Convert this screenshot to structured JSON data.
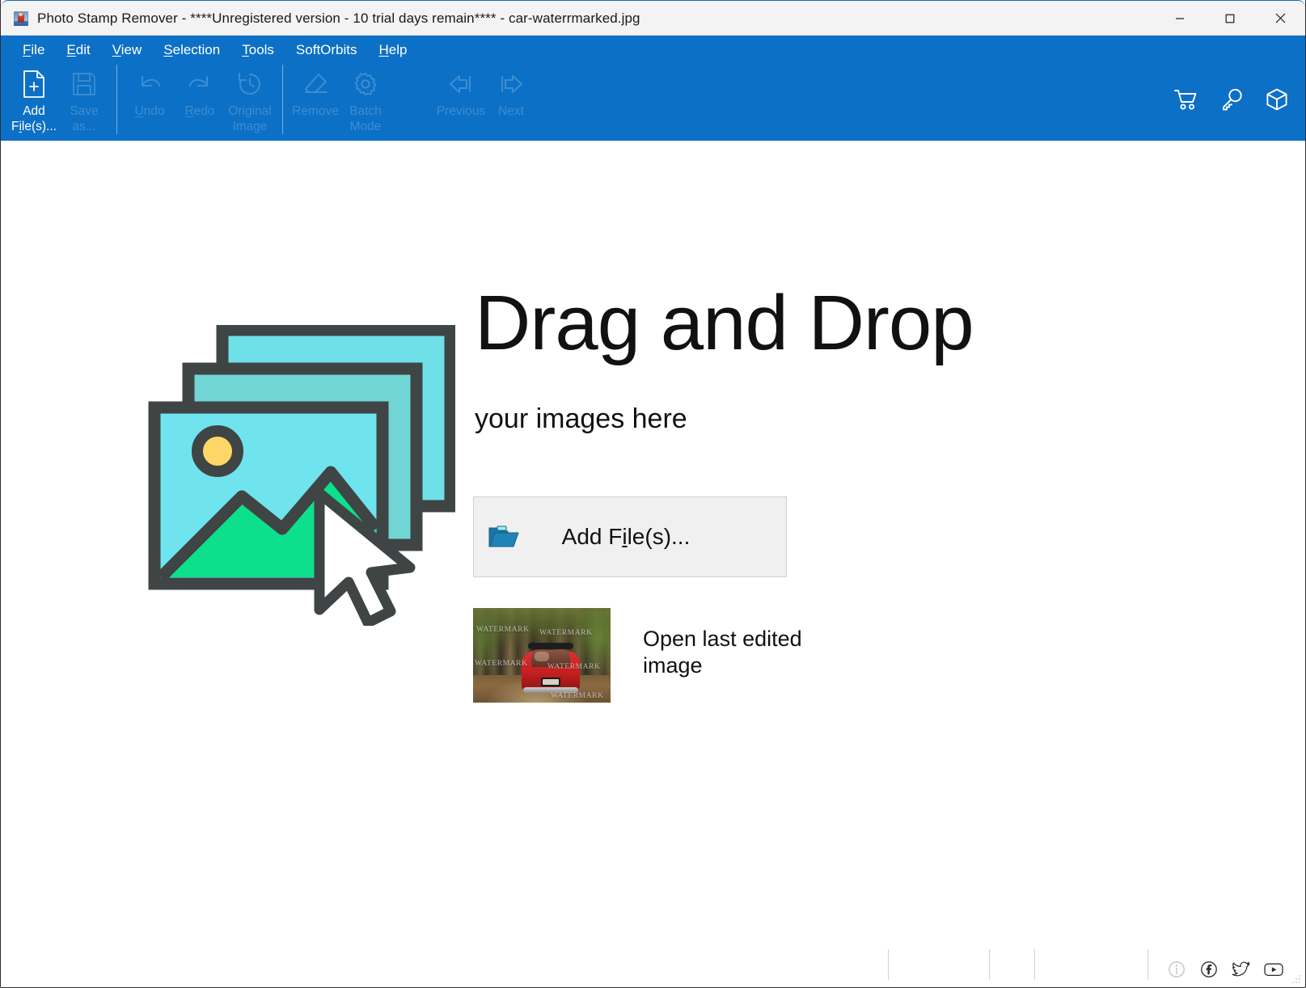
{
  "window": {
    "title": "Photo Stamp Remover - ****Unregistered version - 10 trial days remain**** - car-waterrmarked.jpg",
    "app_icon": "photo-stamp-remover-icon",
    "controls": {
      "minimize": "minimize-icon",
      "maximize": "maximize-icon",
      "close": "close-icon"
    },
    "accent_blue": "#0c70c6",
    "titlebar_bg": "#f3f3f3"
  },
  "menu": {
    "items": [
      {
        "label": "File",
        "accel": "F"
      },
      {
        "label": "Edit",
        "accel": "E"
      },
      {
        "label": "View",
        "accel": "V"
      },
      {
        "label": "Selection",
        "accel": "S"
      },
      {
        "label": "Tools",
        "accel": "T"
      },
      {
        "label": "SoftOrbits",
        "accel": ""
      },
      {
        "label": "Help",
        "accel": "H"
      }
    ]
  },
  "toolbar": {
    "buttons": [
      {
        "id": "add-files",
        "line1": "Add",
        "line2": "File(s)...",
        "icon": "add-file-icon",
        "enabled": true
      },
      {
        "id": "save-as",
        "line1": "Save",
        "line2": "as...",
        "icon": "save-icon",
        "enabled": false
      },
      {
        "id": "undo",
        "line1": "Undo",
        "line2": "",
        "icon": "undo-icon",
        "enabled": false
      },
      {
        "id": "redo",
        "line1": "Redo",
        "line2": "",
        "icon": "redo-icon",
        "enabled": false
      },
      {
        "id": "original-image",
        "line1": "Original",
        "line2": "Image",
        "icon": "history-icon",
        "enabled": false
      },
      {
        "id": "remove",
        "line1": "Remove",
        "line2": "",
        "icon": "eraser-icon",
        "enabled": false
      },
      {
        "id": "batch-mode",
        "line1": "Batch",
        "line2": "Mode",
        "icon": "gear-icon",
        "enabled": false
      },
      {
        "id": "previous",
        "line1": "Previous",
        "line2": "",
        "icon": "arrow-left-bar-icon",
        "enabled": false
      },
      {
        "id": "next",
        "line1": "Next",
        "line2": "",
        "icon": "arrow-right-bar-icon",
        "enabled": false
      }
    ],
    "right_icons": [
      {
        "id": "buy",
        "icon": "shopping-cart-icon"
      },
      {
        "id": "register",
        "icon": "key-icon"
      },
      {
        "id": "products",
        "icon": "box-icon"
      }
    ]
  },
  "main": {
    "headline": "Drag and Drop",
    "subheadline": "your images here",
    "add_files_button": {
      "label": "Add File(s)...",
      "accel": "i",
      "icon": "open-folder-icon",
      "bg": "#f0f0f0"
    },
    "open_last": {
      "label": "Open last edited image",
      "thumbnail_alt": "red-car-forest-watermarked-thumbnail",
      "watermark_text": "WATERMARK"
    },
    "illustration": {
      "name": "drag-and-drop-images-illustration",
      "colors": {
        "outline": "#3f4444",
        "front_sky": "#6fe3ee",
        "mid_sky": "#72d5d5",
        "back_sky": "#6fe0e8",
        "mountain": "#0ce08c",
        "sun": "#ffd766",
        "cursor": "#ffffff"
      }
    }
  },
  "status_bar": {
    "icons": [
      {
        "id": "info",
        "icon": "info-icon",
        "dim": true
      },
      {
        "id": "facebook",
        "icon": "facebook-icon",
        "dim": false
      },
      {
        "id": "twitter",
        "icon": "twitter-icon",
        "dim": false
      },
      {
        "id": "youtube",
        "icon": "youtube-icon",
        "dim": false
      }
    ]
  }
}
